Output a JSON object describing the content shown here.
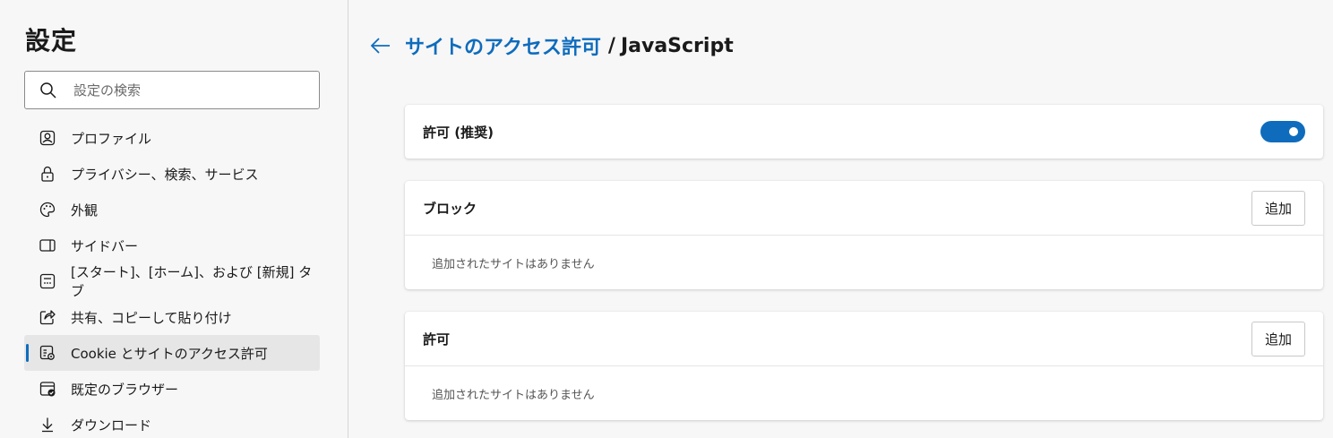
{
  "sidebar": {
    "title": "設定",
    "search_placeholder": "設定の検索",
    "items": [
      {
        "label": "プロファイル",
        "icon": "profile-icon"
      },
      {
        "label": "プライバシー、検索、サービス",
        "icon": "lock-icon"
      },
      {
        "label": "外観",
        "icon": "palette-icon"
      },
      {
        "label": "サイドバー",
        "icon": "sidebar-icon"
      },
      {
        "label": "[スタート]、[ホーム]、および [新規] タブ",
        "icon": "new-tab-icon"
      },
      {
        "label": "共有、コピーして貼り付け",
        "icon": "share-icon"
      },
      {
        "label": "Cookie とサイトのアクセス許可",
        "icon": "site-permissions-icon",
        "active": true
      },
      {
        "label": "既定のブラウザー",
        "icon": "default-browser-icon"
      },
      {
        "label": "ダウンロード",
        "icon": "download-icon"
      }
    ]
  },
  "header": {
    "breadcrumb_link": "サイトのアクセス許可",
    "separator": "/",
    "current": "JavaScript"
  },
  "allowed_setting": {
    "label": "許可 (推奨)",
    "enabled": true
  },
  "block_section": {
    "title": "ブロック",
    "add_label": "追加",
    "empty_text": "追加されたサイトはありません"
  },
  "allow_section": {
    "title": "許可",
    "add_label": "追加",
    "empty_text": "追加されたサイトはありません"
  },
  "colors": {
    "accent": "#0f6cbd",
    "background": "#f7f7f7",
    "card": "#ffffff"
  }
}
